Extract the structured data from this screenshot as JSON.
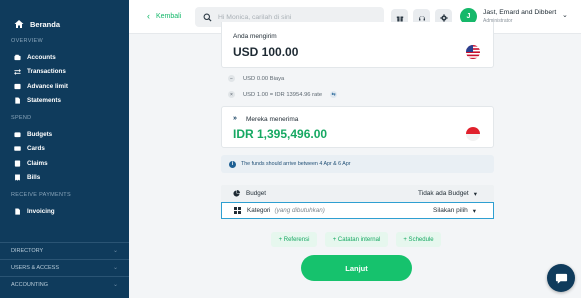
{
  "sidebar": {
    "brand": "Beranda",
    "sections": {
      "overview": "OVERVIEW",
      "spend": "SPEND",
      "receive": "RECEIVE PAYMENTS"
    },
    "overview_items": [
      {
        "label": "Accounts",
        "icon": "wallet-icon"
      },
      {
        "label": "Transactions",
        "icon": "arrows-icon"
      },
      {
        "label": "Advance limit",
        "icon": "limit-icon"
      },
      {
        "label": "Statements",
        "icon": "document-icon"
      }
    ],
    "spend_items": [
      {
        "label": "Budgets",
        "icon": "budget-icon"
      },
      {
        "label": "Cards",
        "icon": "card-icon"
      },
      {
        "label": "Claims",
        "icon": "claims-icon"
      },
      {
        "label": "Bills",
        "icon": "bills-icon"
      }
    ],
    "receive_items": [
      {
        "label": "Invoicing",
        "icon": "invoice-icon"
      }
    ],
    "bottom": [
      "DIRECTORY",
      "USERS & ACCESS",
      "ACCOUNTING"
    ]
  },
  "header": {
    "back_label": "Kembali",
    "search_placeholder": "Hi Monica, carilah di sini",
    "user_name": "Jast, Emard and Dibbert",
    "user_role": "Administrator",
    "avatar_initial": "J"
  },
  "transfer": {
    "send_label": "Anda mengirim",
    "send_amount": "USD 100.00",
    "fee": "USD 0.00 Biaya",
    "rate": "USD 1.00 = IDR 13954.96 rate",
    "receive_label": "Mereka menerima",
    "receive_amount": "IDR 1,395,496.00",
    "arrival_note": "The funds should arrive between 4 Apr & 6 Apr"
  },
  "form": {
    "budget_label": "Budget",
    "budget_value": "Tidak ada Budget",
    "category_label": "Kategori",
    "category_hint": "(yang dibutuhkan)",
    "category_value": "Silakan pilih",
    "chips": [
      "+ Referensi",
      "+ Catatan internal",
      "+ Schedule"
    ],
    "submit_label": "Lanjut"
  },
  "colors": {
    "sidebar_bg": "#0f3b5c",
    "accent_green": "#16c26d",
    "focus_blue": "#2e9fd1"
  }
}
